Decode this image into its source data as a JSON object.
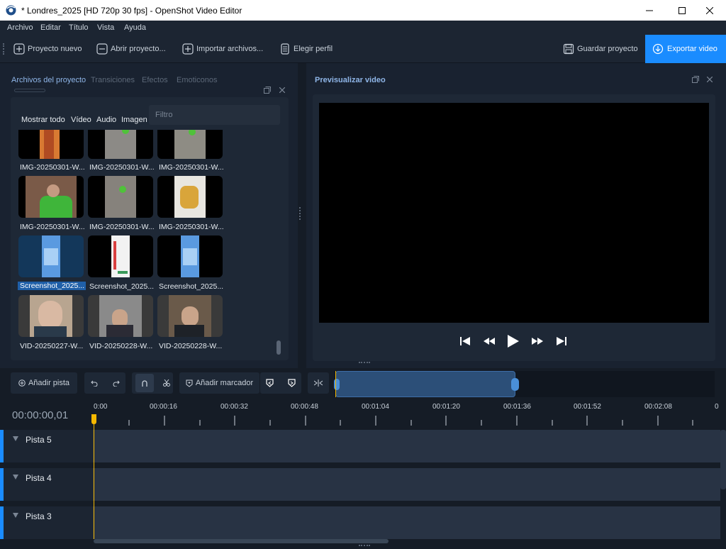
{
  "window": {
    "title": "* Londres_2025 [HD 720p 30 fps] - OpenShot Video Editor"
  },
  "menu": [
    "Archivo",
    "Editar",
    "Título",
    "Vista",
    "Ayuda"
  ],
  "toolbar": {
    "new": "Proyecto nuevo",
    "open": "Abrir proyecto...",
    "import": "Importar archivos...",
    "profile": "Elegir perfil",
    "save": "Guardar proyecto",
    "export": "Exportar video"
  },
  "left_tabs": [
    "Archivos del proyecto",
    "Transiciones",
    "Efectos",
    "Emoticonos"
  ],
  "filters": {
    "all": "Mostrar todo",
    "video": "Vídeo",
    "audio": "Audio",
    "image": "Imagen",
    "placeholder": "Filtro"
  },
  "files": [
    {
      "name": "IMG-20250301-W..."
    },
    {
      "name": "IMG-20250301-W..."
    },
    {
      "name": "IMG-20250301-W..."
    },
    {
      "name": "IMG-20250301-W..."
    },
    {
      "name": "IMG-20250301-W..."
    },
    {
      "name": "IMG-20250301-W..."
    },
    {
      "name": "Screenshot_2025..."
    },
    {
      "name": "Screenshot_2025..."
    },
    {
      "name": "Screenshot_2025..."
    },
    {
      "name": "VID-20250227-W..."
    },
    {
      "name": "VID-20250228-W..."
    },
    {
      "name": "VID-20250228-W..."
    }
  ],
  "preview": {
    "title": "Previsualizar video"
  },
  "timeline": {
    "add_track": "Añadir pista",
    "add_marker": "Añadir marcador",
    "timecode": "00:00:00,01",
    "ticks": [
      "0:00",
      "00:00:16",
      "00:00:32",
      "00:00:48",
      "00:01:04",
      "00:01:20",
      "00:01:36",
      "00:01:52",
      "00:02:08"
    ],
    "tracks": [
      "Pista 5",
      "Pista 4",
      "Pista 3"
    ]
  },
  "colors": {
    "accent": "#1a8cff",
    "playhead": "#f5b800"
  }
}
